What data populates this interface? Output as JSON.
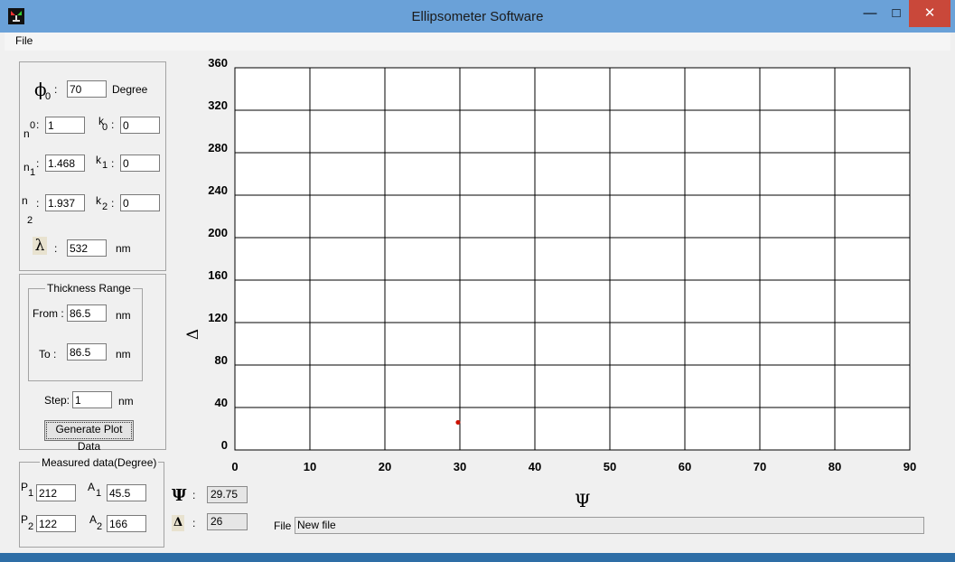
{
  "window": {
    "title": "Ellipsometer Software",
    "controls": {
      "minimize": "—",
      "maximize": "□",
      "close": "✕"
    }
  },
  "menu": {
    "file": "File"
  },
  "optical": {
    "phi_label": "ϕ",
    "phi_sub": "0",
    "phi_value": "70",
    "phi_unit": "Degree",
    "n0_label": "n",
    "n0_sup": "0",
    "n0_value": "1",
    "k0_label": "k",
    "k0_sub": "0",
    "k0_value": "0",
    "n1_label": "n",
    "n1_sub": "1",
    "n1_value": "1.468",
    "k1_label": "k",
    "k1_sub": "1",
    "k1_value": "0",
    "n2_label": "n",
    "n2_sub": "2",
    "n2_value": "1.937",
    "k2_label": "k",
    "k2_sub": "2",
    "k2_value": "0",
    "lambda_label": "λ",
    "lambda_value": "532",
    "lambda_unit": "nm",
    "colon": ":"
  },
  "thickness": {
    "title": "Thickness  Range",
    "from_label": "From :",
    "from_value": "86.5",
    "from_unit": "nm",
    "to_label": "To :",
    "to_value": "86.5",
    "to_unit": "nm",
    "step_label": "Step:",
    "step_value": "1",
    "step_unit": "nm",
    "generate_button": "Generate Plot Data"
  },
  "measured": {
    "title": "Measured data(Degree)",
    "p1_label": "P",
    "p1_sub": "1",
    "p1_value": "212",
    "a1_label": "A",
    "a1_sub": "1",
    "a1_value": "45.5",
    "p2_label": "P",
    "p2_sub": "2",
    "p2_value": "122",
    "a2_label": "A",
    "a2_sub": "2",
    "a2_value": "166"
  },
  "readout": {
    "psi_symbol": "Ψ",
    "psi_colon": ":",
    "psi_value": "29.75",
    "delta_symbol": "Δ",
    "delta_colon": ":",
    "delta_value": "26"
  },
  "file": {
    "label": "File :",
    "value": "New file"
  },
  "chart_data": {
    "type": "scatter",
    "xlabel": "Ψ",
    "ylabel": "Δ",
    "xlim": [
      0,
      90
    ],
    "ylim": [
      0,
      360
    ],
    "x_ticks": [
      0,
      10,
      20,
      30,
      40,
      50,
      60,
      70,
      80,
      90
    ],
    "y_ticks": [
      0,
      40,
      80,
      120,
      160,
      200,
      240,
      280,
      320,
      360
    ],
    "grid": true,
    "point_color": "#cc1100",
    "series": [
      {
        "x": [
          29.75
        ],
        "y": [
          26
        ]
      }
    ]
  }
}
